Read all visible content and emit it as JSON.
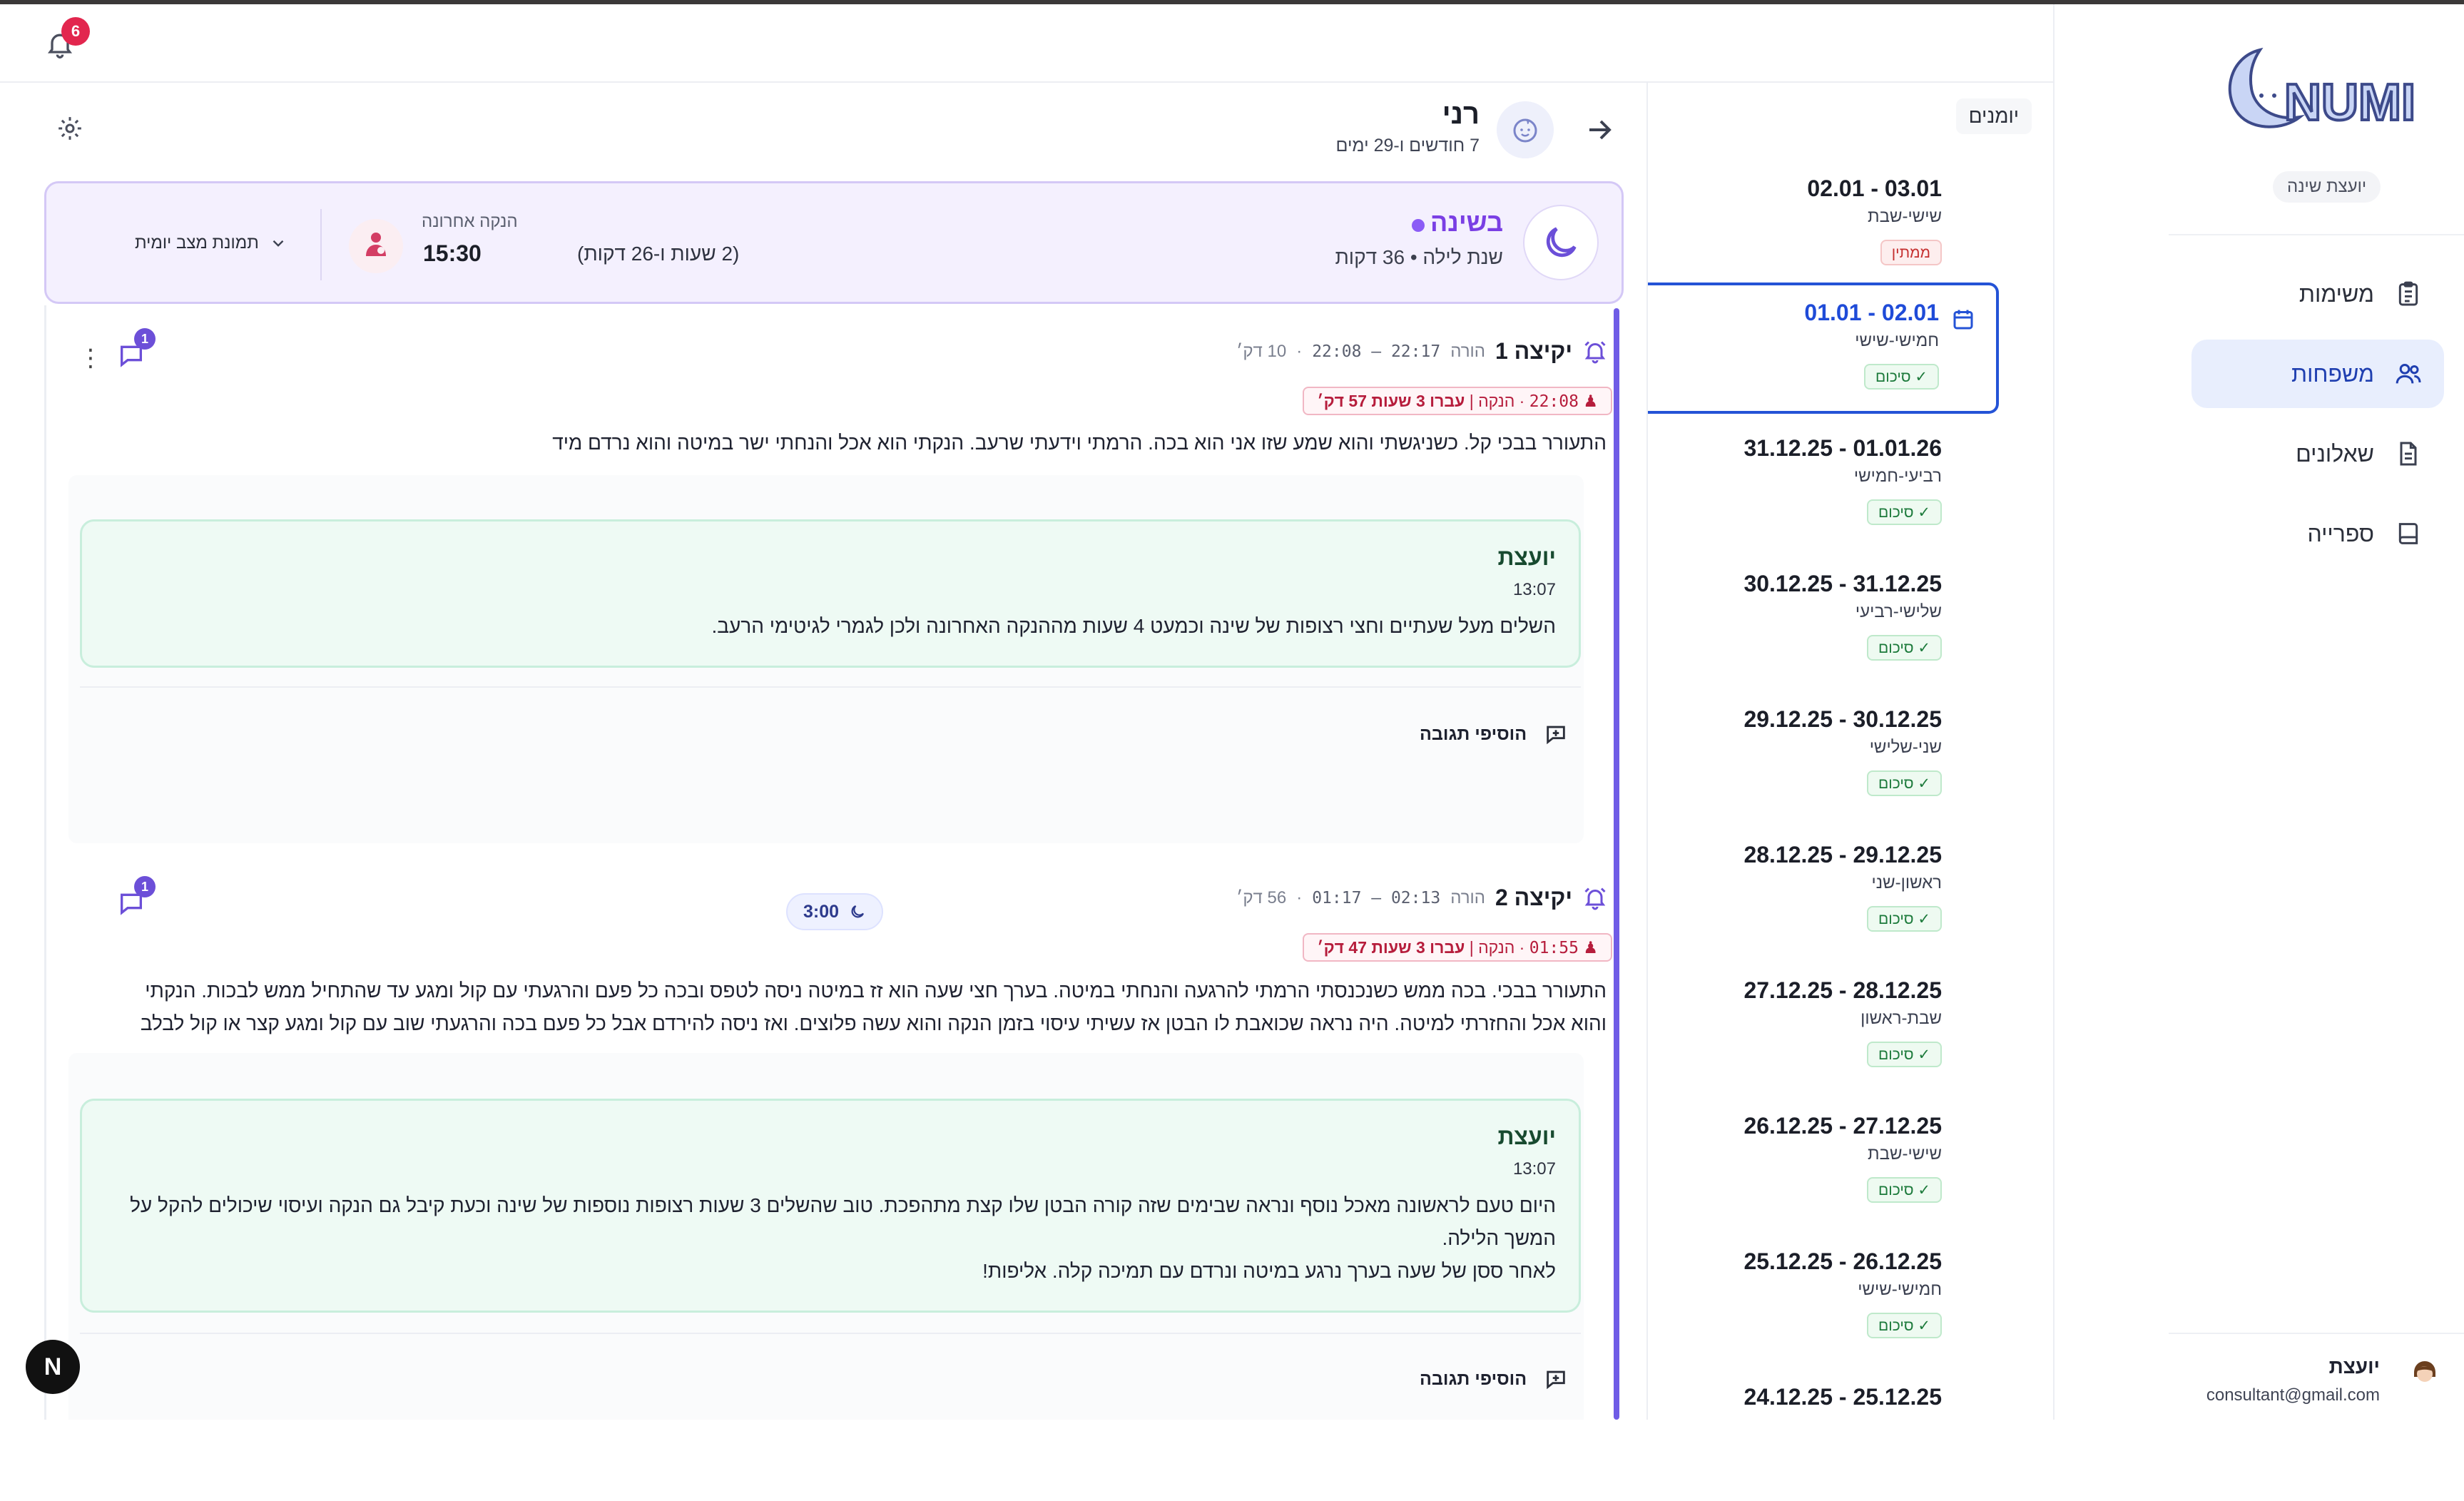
{
  "nav": {
    "role": "יועצת שינה",
    "items": [
      {
        "label": "משימות",
        "icon": "clipboard-icon"
      },
      {
        "label": "משפחות",
        "icon": "users-icon"
      },
      {
        "label": "שאלונים",
        "icon": "file-text-icon"
      },
      {
        "label": "ספרייה",
        "icon": "book-icon"
      }
    ],
    "active_index": 1,
    "user": {
      "name": "יועצת",
      "email": "consultant@gmail.com"
    }
  },
  "header": {
    "notifications_count": "6"
  },
  "journals": {
    "title": "יומנים",
    "entries": [
      {
        "range": "02.01 - 03.01",
        "days": "שישי-שבת",
        "status": "ממתין",
        "kind": "wait"
      },
      {
        "range": "01.01 - 02.01",
        "days": "חמישי-שישי",
        "status": "סיכום",
        "kind": "done",
        "active": true
      },
      {
        "range": "31.12.25 - 01.01.26",
        "days": "רביעי-חמישי",
        "status": "סיכום",
        "kind": "done"
      },
      {
        "range": "30.12.25 - 31.12.25",
        "days": "שלישי-רביעי",
        "status": "סיכום",
        "kind": "done"
      },
      {
        "range": "29.12.25 - 30.12.25",
        "days": "שני-שלישי",
        "status": "סיכום",
        "kind": "done"
      },
      {
        "range": "28.12.25 - 29.12.25",
        "days": "ראשון-שני",
        "status": "סיכום",
        "kind": "done"
      },
      {
        "range": "27.12.25 - 28.12.25",
        "days": "שבת-ראשון",
        "status": "סיכום",
        "kind": "done"
      },
      {
        "range": "26.12.25 - 27.12.25",
        "days": "שישי-שבת",
        "status": "סיכום",
        "kind": "done"
      },
      {
        "range": "25.12.25 - 26.12.25",
        "days": "חמישי-שישי",
        "status": "סיכום",
        "kind": "done"
      },
      {
        "range": "24.12.25 - 25.12.25",
        "days": "",
        "status": "",
        "kind": "done"
      }
    ]
  },
  "child": {
    "name": "רני",
    "age": "7 חודשים ו-29 ימים"
  },
  "status": {
    "title": "בשינה",
    "subtitle": "שנת לילה • 36 דקות",
    "last_feed_label": "הנקה אחרונה",
    "last_feed_time": "15:30",
    "last_feed_elapsed": "(2 שעות ו-26 דקות)",
    "snapshot_label": "תמונת מצב יומית"
  },
  "colors": {
    "accent": "#2453d6",
    "sleep": "#7a3fe4",
    "feed": "#b61d3c",
    "consultant_bg": "#eefaf4"
  },
  "timeline": {
    "wakes": [
      {
        "title": "יקיצה 1",
        "role": "הורה",
        "time": "22:08 – 22:17",
        "duration": "10 דק׳",
        "comments": "1",
        "tag_time": "22:08",
        "tag_label": "הנקה",
        "tag_elapsed": "עברו 3 שעות 57 דק׳",
        "text": "התעורר בבכי קל. כשניגשתי והוא שמע שזו אני הוא בכה. הרמתי וידעתי שרעב. הנקתי הוא אכל והנחתי ישר במיטה והוא נרדם מיד",
        "reply": {
          "who": "יועצת",
          "when": "13:07",
          "text": "השלים מעל שעתיים וחצי רצופות של שינה וכמעט 4 שעות מההנקה האחרונה ולכן לגמרי לגיטימי הרעב."
        }
      },
      {
        "title": "יקיצה 2",
        "role": "הורה",
        "time": "01:17 – 02:13",
        "duration": "56 דק׳",
        "comments": "1",
        "tag_time": "01:55",
        "tag_label": "הנקה",
        "tag_elapsed": "עברו 3 שעות 47 דק׳",
        "text": "התעורר בבכי. בכה ממש כשנכנסתי הרמתי להרגעה והנחתי במיטה. בערך חצי שעה הוא זז במיטה ניסה לטפס ובכה כל פעם והרגעתי עם קול ומגע עד שהתחיל ממש לבכות. הנקתי והוא אכל והחזרתי למיטה. היה נראה שכואבת לו הבטן אז עשיתי עיסוי בזמן הנקה והוא עשה פלוצים. ואז ניסה להירדם אבל כל פעם בכה והרגעתי שוב עם קול ומגע קצר או קול לבלב",
        "reply": {
          "who": "יועצת",
          "when": "13:07",
          "text": "היום טעם לראשונה מאכל נוסף ונראה שבימים שזה קורה הבטן שלו קצת מתהפכת. טוב שהשלים 3 שעות רצופות נוספות של שינה וכעת קיבל גם הנקה ועיסוי שיכולים להקל על המשך הלילה.",
          "text2": "לאחר ססן של שעה בערך נרגע במיטה ונרדם עם תמיכה קלה. אליפות!"
        }
      }
    ],
    "add_reply_label": "הוסיפי תגובה",
    "sleep_marker": "3:00"
  },
  "fab_label": "N"
}
